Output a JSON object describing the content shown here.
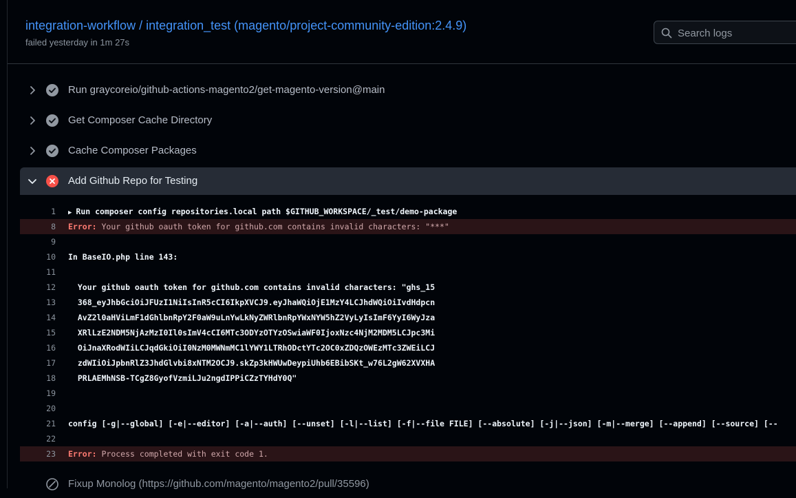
{
  "header": {
    "title": "integration-workflow / integration_test (magento/project-community-edition:2.4.9)",
    "subtitle": "failed yesterday in 1m 27s"
  },
  "search": {
    "placeholder": "Search logs"
  },
  "steps": [
    {
      "label": "Run graycoreio/github-actions-magento2/get-magento-version@main",
      "status": "success"
    },
    {
      "label": "Get Composer Cache Directory",
      "status": "success"
    },
    {
      "label": "Cache Composer Packages",
      "status": "success"
    },
    {
      "label": "Add Github Repo for Testing",
      "status": "failure",
      "expanded": true
    },
    {
      "label": "Fixup Monolog (https://github.com/magento/magento2/pull/35596)",
      "status": "skipped"
    }
  ],
  "log": [
    {
      "n": "1",
      "t": "Run composer config repositories.local path $GITHUB_WORKSPACE/_test/demo-package",
      "kind": "group"
    },
    {
      "n": "8",
      "prefix": "Error:",
      "t": " Your github oauth token for github.com contains invalid characters: \"***\"",
      "kind": "error"
    },
    {
      "n": "9",
      "t": ""
    },
    {
      "n": "10",
      "t": "In BaseIO.php line 143:"
    },
    {
      "n": "11",
      "t": ""
    },
    {
      "n": "12",
      "t": "  Your github oauth token for github.com contains invalid characters: \"ghs_15"
    },
    {
      "n": "13",
      "t": "  368_eyJhbGciOiJFUzI1NiIsInR5cCI6IkpXVCJ9.eyJhaWQiOjE1MzY4LCJhdWQiOiIvdHdpcn"
    },
    {
      "n": "14",
      "t": "  AvZ2l0aHViLmF1dGhlbnRpY2F0aW9uLnYwLkNyZWRlbnRpYWxNYW5hZ2VyLyIsImF6YyI6WyJza"
    },
    {
      "n": "15",
      "t": "  XRlLzE2NDM5NjAzMzI0Il0sImV4cCI6MTc3ODYzOTYzOSwiaWF0IjoxNzc4NjM2MDM5LCJpc3Mi"
    },
    {
      "n": "16",
      "t": "  OiJnaXRodWIiLCJqdGkiOiI0NzM0MWNmMC1lYWY1LTRhODctYTc2OC0xZDQzOWEzMTc3ZWEiLCJ"
    },
    {
      "n": "17",
      "t": "  zdWIiOiJpbnRlZ3JhdGlvbi8xNTM2OCJ9.skZp3kHWUwDeypiUhb6EBibSKt_w76L2gW62XVXHA"
    },
    {
      "n": "18",
      "t": "  PRLAEMhNSB-TCgZ8GyofVzmiLJu2ngdIPPiCZzTYHdY0Q\""
    },
    {
      "n": "19",
      "t": ""
    },
    {
      "n": "20",
      "t": ""
    },
    {
      "n": "21",
      "t": "config [-g|--global] [-e|--editor] [-a|--auth] [--unset] [-l|--list] [-f|--file FILE] [--absolute] [-j|--json] [-m|--merge] [--append] [--source] [--"
    },
    {
      "n": "22",
      "t": ""
    },
    {
      "n": "23",
      "prefix": "Error:",
      "t": " Process completed with exit code 1.",
      "kind": "error"
    }
  ]
}
